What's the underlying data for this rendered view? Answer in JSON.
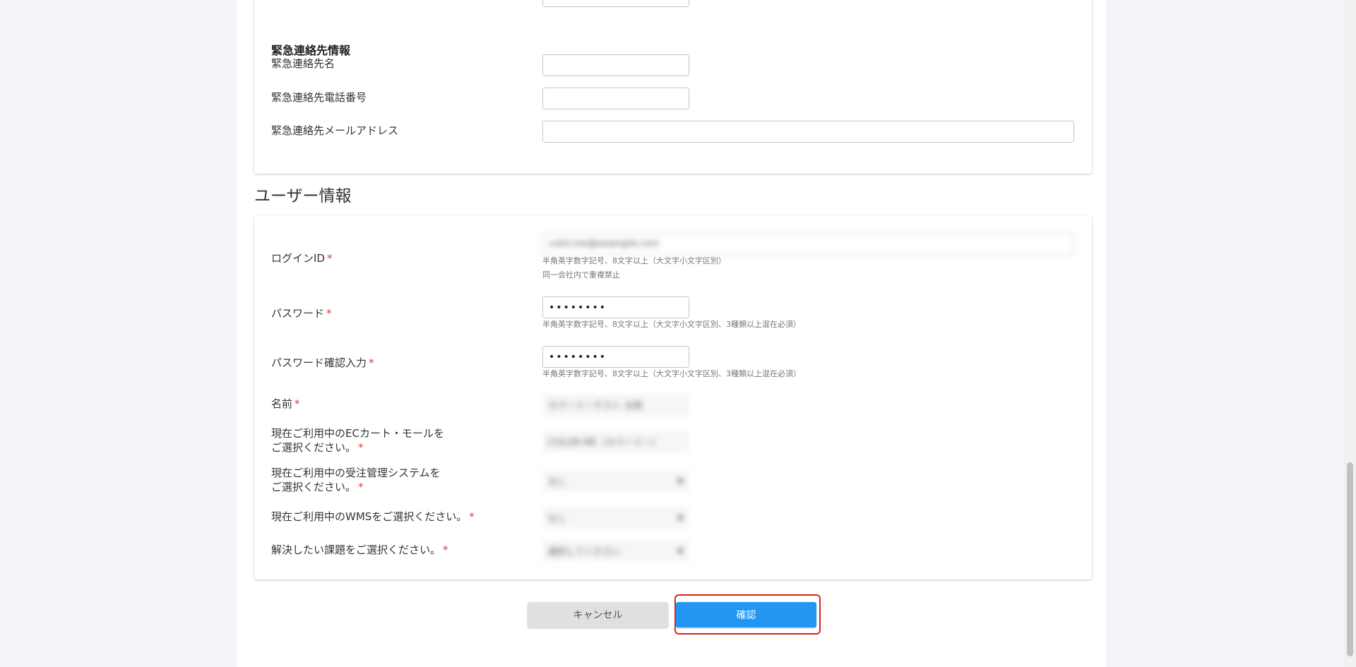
{
  "emergency": {
    "title": "緊急連絡先情報",
    "name_label": "緊急連絡先名",
    "phone_label": "緊急連絡先電話番号",
    "email_label": "緊急連絡先メールアドレス",
    "name_value": "",
    "phone_value": "",
    "email_value": ""
  },
  "user": {
    "section_title": "ユーザー情報",
    "required_mark": "*",
    "login_id_label": "ログインID",
    "login_id_value": "color.me@example.com",
    "login_id_hint1": "半角英字数字記号、8文字以上（大文字小文字区別）",
    "login_id_hint2": "同一会社内で重複禁止",
    "password_label": "パスワード",
    "password_value": "••••••••",
    "password_hint": "半角英字数字記号、8文字以上（大文字小文字区別、3種類以上混在必須）",
    "password_confirm_label": "パスワード確認入力",
    "password_confirm_value": "••••••••",
    "password_confirm_hint": "半角英字数字記号、8文字以上（大文字小文字区別、3種類以上混在必須）",
    "name_label": "名前",
    "name_value": "カラーミーテスト 太郎",
    "ec_label_line1": "現在ご利用中のECカート・モールを",
    "ec_label_line2": "ご選択ください。",
    "ec_value": "COLOR ME（カラーミー）",
    "oms_label_line1": "現在ご利用中の受注管理システムを",
    "oms_label_line2": "ご選択ください。",
    "oms_value": "なし",
    "wms_label": "現在ご利用中のWMSをご選択ください。",
    "wms_value": "なし",
    "issue_label": "解決したい課題をご選択ください。",
    "issue_value": "選択してください"
  },
  "buttons": {
    "cancel": "キャンセル",
    "confirm": "確認"
  },
  "colors": {
    "primary": "#2196f3",
    "required": "#e53935",
    "highlight": "#e02020"
  }
}
